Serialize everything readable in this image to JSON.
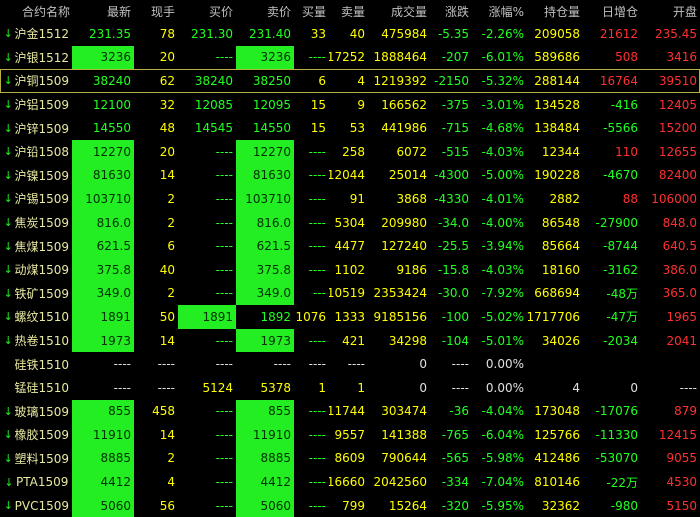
{
  "colors": {
    "up": "#ff3030",
    "down": "#22ff22",
    "flat": "#e0e0e0",
    "name": "#e8e8a0",
    "highlight": "#22ee22",
    "header": "#c0c0c0",
    "yellow": "#ffff00"
  },
  "header": [
    "合约名称",
    "最新",
    "现手",
    "买价",
    "卖价",
    "买量",
    "卖量",
    "成交量",
    "涨跌",
    "涨幅%",
    "持仓量",
    "日增仓",
    "开盘"
  ],
  "rows": [
    {
      "arrow": "down",
      "name": "沪金1512",
      "c": [
        "231.35",
        "78",
        "231.30",
        "231.40",
        "33",
        "40",
        "475984",
        "-5.35",
        "-2.26%",
        "209058",
        "21612",
        "235.45"
      ],
      "hl": [],
      "col": [
        "g",
        "f",
        "g",
        "g",
        "f",
        "f",
        "f",
        "g",
        "g",
        "f",
        "r",
        "r"
      ]
    },
    {
      "arrow": "down",
      "name": "沪银1512",
      "c": [
        "3236",
        "20",
        "----",
        "3236",
        "----",
        "17252",
        "1888464",
        "-207",
        "-6.01%",
        "589686",
        "508",
        "3416"
      ],
      "hl": [
        0,
        3
      ],
      "col": [
        "d",
        "f",
        "g",
        "d",
        "g",
        "f",
        "f",
        "g",
        "g",
        "f",
        "r",
        "r"
      ]
    },
    {
      "arrow": "down",
      "name": "沪铜1509",
      "c": [
        "38240",
        "62",
        "38240",
        "38250",
        "6",
        "4",
        "1219392",
        "-2150",
        "-5.32%",
        "288144",
        "16764",
        "39510"
      ],
      "hl": [],
      "col": [
        "g",
        "f",
        "g",
        "g",
        "f",
        "f",
        "f",
        "g",
        "g",
        "f",
        "r",
        "r"
      ],
      "sel": true
    },
    {
      "arrow": "down",
      "name": "沪铝1509",
      "c": [
        "12100",
        "32",
        "12085",
        "12095",
        "15",
        "9",
        "166562",
        "-375",
        "-3.01%",
        "134528",
        "-416",
        "12405"
      ],
      "hl": [],
      "col": [
        "g",
        "f",
        "g",
        "g",
        "f",
        "f",
        "f",
        "g",
        "g",
        "f",
        "g",
        "r"
      ]
    },
    {
      "arrow": "down",
      "name": "沪锌1509",
      "c": [
        "14550",
        "48",
        "14545",
        "14550",
        "15",
        "53",
        "441986",
        "-715",
        "-4.68%",
        "138484",
        "-5566",
        "15200"
      ],
      "hl": [],
      "col": [
        "g",
        "f",
        "g",
        "g",
        "f",
        "f",
        "f",
        "g",
        "g",
        "f",
        "g",
        "r"
      ]
    },
    {
      "arrow": "down",
      "name": "沪铅1508",
      "c": [
        "12270",
        "20",
        "----",
        "12270",
        "----",
        "258",
        "6072",
        "-515",
        "-4.03%",
        "12344",
        "110",
        "12655"
      ],
      "hl": [
        0,
        3
      ],
      "col": [
        "d",
        "f",
        "g",
        "d",
        "g",
        "f",
        "f",
        "g",
        "g",
        "f",
        "r",
        "r"
      ]
    },
    {
      "arrow": "down",
      "name": "沪镍1509",
      "c": [
        "81630",
        "14",
        "----",
        "81630",
        "----",
        "12044",
        "25014",
        "-4300",
        "-5.00%",
        "190228",
        "-4670",
        "82400"
      ],
      "hl": [
        0,
        3
      ],
      "col": [
        "d",
        "f",
        "g",
        "d",
        "g",
        "f",
        "f",
        "g",
        "g",
        "f",
        "g",
        "r"
      ]
    },
    {
      "arrow": "down",
      "name": "沪锡1509",
      "c": [
        "103710",
        "2",
        "----",
        "103710",
        "----",
        "91",
        "3868",
        "-4330",
        "-4.01%",
        "2882",
        "88",
        "106000"
      ],
      "hl": [
        0,
        3
      ],
      "col": [
        "d",
        "f",
        "g",
        "d",
        "g",
        "f",
        "f",
        "g",
        "g",
        "f",
        "r",
        "r"
      ]
    },
    {
      "arrow": "down",
      "name": "焦炭1509",
      "c": [
        "816.0",
        "2",
        "----",
        "816.0",
        "----",
        "5304",
        "209980",
        "-34.0",
        "-4.00%",
        "86548",
        "-27900",
        "848.0"
      ],
      "hl": [
        0,
        3
      ],
      "col": [
        "d",
        "f",
        "g",
        "d",
        "g",
        "f",
        "f",
        "g",
        "g",
        "f",
        "g",
        "r"
      ]
    },
    {
      "arrow": "down",
      "name": "焦煤1509",
      "c": [
        "621.5",
        "6",
        "----",
        "621.5",
        "----",
        "4477",
        "127240",
        "-25.5",
        "-3.94%",
        "85664",
        "-8744",
        "640.5"
      ],
      "hl": [
        0,
        3
      ],
      "col": [
        "d",
        "f",
        "g",
        "d",
        "g",
        "f",
        "f",
        "g",
        "g",
        "f",
        "g",
        "r"
      ]
    },
    {
      "arrow": "down",
      "name": "动煤1509",
      "c": [
        "375.8",
        "40",
        "----",
        "375.8",
        "----",
        "1102",
        "9186",
        "-15.8",
        "-4.03%",
        "18160",
        "-3162",
        "386.0"
      ],
      "hl": [
        0,
        3
      ],
      "col": [
        "d",
        "f",
        "g",
        "d",
        "g",
        "f",
        "f",
        "g",
        "g",
        "f",
        "g",
        "r"
      ]
    },
    {
      "arrow": "down",
      "name": "铁矿1509",
      "c": [
        "349.0",
        "2",
        "----",
        "349.0",
        "---",
        "110519",
        "2353424",
        "-30.0",
        "-7.92%",
        "668694",
        "-48万",
        "365.0"
      ],
      "hl": [
        0,
        3
      ],
      "col": [
        "d",
        "f",
        "g",
        "d",
        "g",
        "f",
        "f",
        "g",
        "g",
        "f",
        "g",
        "r"
      ]
    },
    {
      "arrow": "down",
      "name": "螺纹1510",
      "c": [
        "1891",
        "50",
        "1891",
        "1892",
        "1076",
        "1333",
        "9185156",
        "-100",
        "-5.02%",
        "1717706",
        "-47万",
        "1965"
      ],
      "hl": [
        0,
        2
      ],
      "col": [
        "d",
        "f",
        "d",
        "g",
        "f",
        "f",
        "f",
        "g",
        "g",
        "f",
        "g",
        "r"
      ]
    },
    {
      "arrow": "down",
      "name": "热卷1510",
      "c": [
        "1973",
        "14",
        "----",
        "1973",
        "----",
        "421",
        "34298",
        "-104",
        "-5.01%",
        "34026",
        "-2034",
        "2041"
      ],
      "hl": [
        0,
        3
      ],
      "col": [
        "d",
        "f",
        "g",
        "d",
        "g",
        "f",
        "f",
        "g",
        "g",
        "f",
        "g",
        "r"
      ]
    },
    {
      "arrow": "none",
      "name": "硅铁1510",
      "c": [
        "----",
        "----",
        "----",
        "----",
        "----",
        "----",
        "0",
        "----",
        "0.00%",
        "",
        "",
        ""
      ],
      "hl": [],
      "col": [
        "w",
        "w",
        "w",
        "w",
        "w",
        "w",
        "w",
        "w",
        "w",
        "w",
        "w",
        "w"
      ]
    },
    {
      "arrow": "none",
      "name": "锰硅1510",
      "c": [
        "----",
        "----",
        "5124",
        "5378",
        "1",
        "1",
        "0",
        "----",
        "0.00%",
        "4",
        "0",
        "----"
      ],
      "hl": [],
      "col": [
        "w",
        "w",
        "f",
        "f",
        "f",
        "f",
        "w",
        "w",
        "w",
        "w",
        "w",
        "w"
      ]
    },
    {
      "arrow": "down",
      "name": "玻璃1509",
      "c": [
        "855",
        "458",
        "----",
        "855",
        "----",
        "11744",
        "303474",
        "-36",
        "-4.04%",
        "173048",
        "-17076",
        "879"
      ],
      "hl": [
        0,
        3
      ],
      "col": [
        "d",
        "f",
        "g",
        "d",
        "g",
        "f",
        "f",
        "g",
        "g",
        "f",
        "g",
        "r"
      ]
    },
    {
      "arrow": "down",
      "name": "橡胶1509",
      "c": [
        "11910",
        "14",
        "----",
        "11910",
        "----",
        "9557",
        "141388",
        "-765",
        "-6.04%",
        "125766",
        "-11330",
        "12415"
      ],
      "hl": [
        0,
        3
      ],
      "col": [
        "d",
        "f",
        "g",
        "d",
        "g",
        "f",
        "f",
        "g",
        "g",
        "f",
        "g",
        "r"
      ]
    },
    {
      "arrow": "down",
      "name": "塑料1509",
      "c": [
        "8885",
        "2",
        "----",
        "8885",
        "----",
        "8609",
        "790644",
        "-565",
        "-5.98%",
        "412486",
        "-53070",
        "9055"
      ],
      "hl": [
        0,
        3
      ],
      "col": [
        "d",
        "f",
        "g",
        "d",
        "g",
        "f",
        "f",
        "g",
        "g",
        "f",
        "g",
        "r"
      ]
    },
    {
      "arrow": "down",
      "name": "PTA1509",
      "c": [
        "4412",
        "4",
        "----",
        "4412",
        "----",
        "16660",
        "2042560",
        "-334",
        "-7.04%",
        "810146",
        "-22万",
        "4530"
      ],
      "hl": [
        0,
        3
      ],
      "col": [
        "d",
        "f",
        "g",
        "d",
        "g",
        "f",
        "f",
        "g",
        "g",
        "f",
        "g",
        "r"
      ]
    },
    {
      "arrow": "down",
      "name": "PVC1509",
      "c": [
        "5060",
        "56",
        "----",
        "5060",
        "----",
        "799",
        "15264",
        "-320",
        "-5.95%",
        "32362",
        "-980",
        "5150"
      ],
      "hl": [
        0,
        3
      ],
      "col": [
        "d",
        "f",
        "g",
        "d",
        "g",
        "f",
        "f",
        "g",
        "g",
        "f",
        "g",
        "r"
      ]
    }
  ],
  "icons": {
    "down": "down-arrow-icon"
  }
}
